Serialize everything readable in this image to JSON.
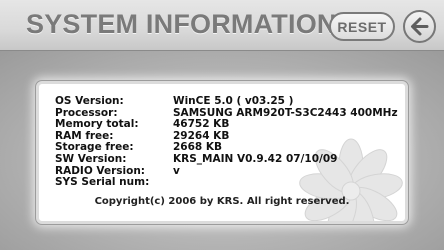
{
  "header": {
    "title": "SYSTEM INFORMATION",
    "reset_label": "RESET",
    "back_icon": "back-arrow-icon"
  },
  "info": {
    "rows": [
      {
        "label": "OS Version:",
        "value": "WinCE 5.0 ( v03.25 )"
      },
      {
        "label": "Processor:",
        "value": "SAMSUNG ARM920T-S3C2443 400MHz"
      },
      {
        "label": "Memory total:",
        "value": "46752 KB"
      },
      {
        "label": "RAM free:",
        "value": "29264 KB"
      },
      {
        "label": "Storage free:",
        "value": "2668 KB"
      },
      {
        "label": "SW Version:",
        "value": "KRS_MAIN V0.9.42 07/10/09"
      },
      {
        "label": "RADIO Version:",
        "value": "v"
      },
      {
        "label": "SYS Serial num:",
        "value": ""
      }
    ],
    "copyright": "Copyright(c) 2006 by KRS. All right reserved."
  },
  "colors": {
    "header_bg": "#d9d9d9",
    "title_text": "#7a7a7a",
    "content_bg": "#b3b3b3",
    "panel_bg": "#ffffff"
  }
}
